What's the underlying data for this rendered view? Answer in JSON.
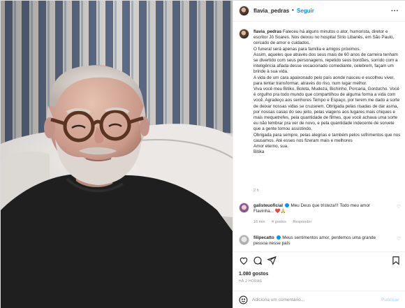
{
  "post": {
    "image_alt": "Foto de homem idoso de barba branca e óculos, deitado em cama com travesseiros brancos",
    "header": {
      "username": "flavia_pedras",
      "separator": "•",
      "follow_label": "Seguir",
      "more_icon": "more-horizontal-icon",
      "more_label": "..."
    },
    "caption": {
      "username": "flavia_pedras",
      "paragraphs": [
        "Faleceu há alguns minutos o ator, humorista, diretor e escritor Jô Soares. Nos deixou no hospital Sírio Libanês, em São Paulo, cercado de amor e cuidados.",
        "O funeral será apenas para família e amigos próximos.",
        "Assim, aqueles que através dos seus mais de 60 anos de carreira tenham se divertido com seus personagens, repetido seus bordões, sorrido com a inteligência afiada desse vocacionado comediante, celebrem, façam um brinde à sua vida.",
        "A vida de um cara apaixonado pelo país aonde nasceu e escolheu viver, para tentar transformar, através do riso, num lugar melhor.",
        "Viva você meu Bitiko, Bolota, Mudeza, Bichinho, Porcaria, Gorducho. Você é orgulho pra todo mundo que compartilhou de alguma forma a vida com você. Agradeço aos senhores Tempo e Espaço, por terem me dado a sorte de deixar nossas vidas se cruzarem. Obrigada pelas risadas de dar asma, por nossas casas do seu jeito, pelas viagens aos lugares mais chiques e mais mequetrefes, pela quantidade de filmes, que você achava uma sorte eu não lembrar pra ver de novo, e pela quantidade indecente de sorvete que a gente tomou assistindo.",
        "Obrigada para sempre, pelas alegrias e também pelos sofrimentos que nos causamos. Até esses nos fizeram mais e melhores",
        "Amor eterno, sua.",
        "Bitika"
      ],
      "time": "2 h"
    },
    "comments": [
      {
        "username": "galisteuoficial",
        "text": "Meu Deus que tristeza!!! Todo meu amor Flavinha... ❤️🙏",
        "badge_icon": "verified-icon",
        "time": "16 min",
        "likes": "4 gostos",
        "reply_label": "Responder",
        "heart_icon": "heart-icon"
      },
      {
        "username": "filipecatto",
        "text": "Meus sentimentos amor, perdemos uma grande pessoa nesse país",
        "badge_icon": "verified-icon",
        "heart_icon": "heart-icon"
      }
    ],
    "actions": {
      "like_icon": "heart-icon",
      "comment_icon": "comment-icon",
      "share_icon": "share-icon",
      "save_icon": "bookmark-icon"
    },
    "likes_label": "1.080 gostos",
    "posted_ago": "HÁ 2 HORAS",
    "add_comment": {
      "emoji_icon": "emoji-icon",
      "placeholder": "Adiciona um comentário...",
      "publish_label": "Publicar"
    },
    "colors": {
      "link_blue": "#0095f6",
      "publish_disabled": "#b2dffc",
      "muted_text": "#8e8e8e",
      "text": "#262626",
      "verified": "#0095f6",
      "heart_red": "#ed4956"
    }
  }
}
